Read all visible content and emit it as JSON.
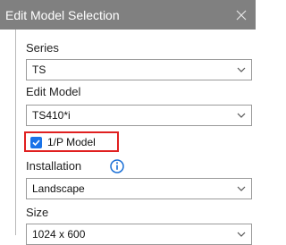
{
  "dialog": {
    "title": "Edit Model Selection",
    "close_glyph": "×"
  },
  "fields": {
    "series": {
      "label": "Series",
      "value": "TS"
    },
    "edit_model": {
      "label": "Edit Model",
      "value": "TS410*i"
    },
    "one_p_model": {
      "label": "1/P Model",
      "checked": true
    },
    "installation": {
      "label": "Installation",
      "value": "Landscape"
    },
    "size": {
      "label": "Size",
      "value": "1024 x 600"
    }
  },
  "colors": {
    "titlebar_bg": "#808080",
    "checkbox_blue": "#1a73e8",
    "highlight_red": "#e02020",
    "info_icon_blue": "#1a6fd6"
  },
  "icons": [
    "close-icon",
    "chevron-down-icon",
    "check-icon",
    "info-icon"
  ]
}
